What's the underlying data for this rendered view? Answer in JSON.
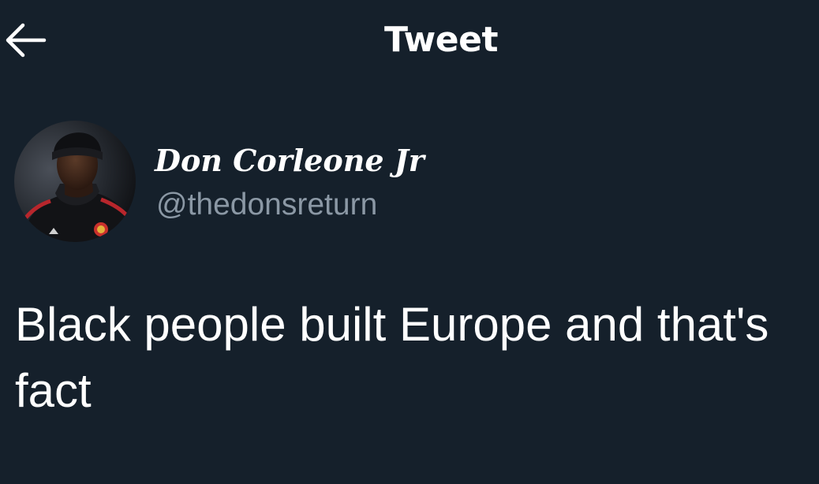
{
  "header": {
    "title": "Tweet",
    "back_icon": "arrow-left-icon"
  },
  "author": {
    "display_name": "Don Corleone Jr",
    "handle": "@thedonsreturn",
    "avatar_icon": "profile-photo"
  },
  "tweet": {
    "text": "Black people built Europe and that's fact"
  },
  "colors": {
    "background": "#15202b",
    "primary_text": "#ffffff",
    "secondary_text": "#8b98a5"
  }
}
